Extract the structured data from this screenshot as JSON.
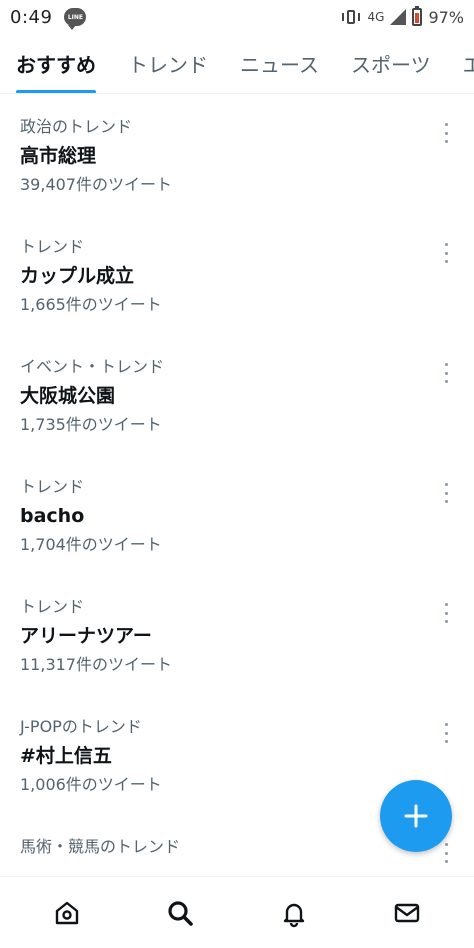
{
  "status_bar": {
    "time": "0:49",
    "line_badge": "LINE",
    "network": "4G",
    "battery": "97%",
    "icons": [
      "line-app-icon",
      "vibrate-icon",
      "signal-icon",
      "battery-icon"
    ]
  },
  "tabs": [
    {
      "label": "おすすめ",
      "active": true
    },
    {
      "label": "トレンド",
      "active": false
    },
    {
      "label": "ニュース",
      "active": false
    },
    {
      "label": "スポーツ",
      "active": false
    },
    {
      "label": "エ",
      "active": false
    }
  ],
  "trends": [
    {
      "context": "政治のトレンド",
      "name": "高市総理",
      "count": "39,407件のツイート"
    },
    {
      "context": "トレンド",
      "name": "カップル成立",
      "count": "1,665件のツイート"
    },
    {
      "context": "イベント・トレンド",
      "name": "大阪城公園",
      "count": "1,735件のツイート"
    },
    {
      "context": "トレンド",
      "name": "bacho",
      "count": "1,704件のツイート"
    },
    {
      "context": "トレンド",
      "name": "アリーナツアー",
      "count": "11,317件のツイート"
    },
    {
      "context": "J-POPのトレンド",
      "name": "#村上信五",
      "count": "1,006件のツイート"
    },
    {
      "context": "馬術・競馬のトレンド",
      "name": "",
      "count": ""
    }
  ],
  "fab": {
    "icon": "plus-icon"
  },
  "bottom_nav": [
    "home-icon",
    "search-icon",
    "notifications-bell-icon",
    "messages-envelope-icon"
  ],
  "colors": {
    "accent": "#1d9bf0",
    "text_primary": "#0f1419",
    "text_secondary": "#536471"
  }
}
